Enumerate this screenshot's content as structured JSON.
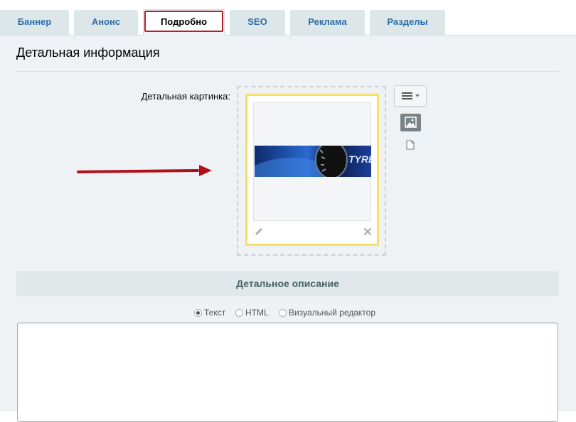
{
  "tabs": [
    {
      "label": "Баннер",
      "active": false
    },
    {
      "label": "Анонс",
      "active": false
    },
    {
      "label": "Подробно",
      "active": true
    },
    {
      "label": "SEO",
      "active": false
    },
    {
      "label": "Реклама",
      "active": false
    },
    {
      "label": "Разделы",
      "active": false
    }
  ],
  "section": {
    "title": "Детальная информация"
  },
  "detail_picture": {
    "label": "Детальная картинка:",
    "edit_icon": "pencil-icon",
    "delete_icon": "close-icon",
    "banner_text": "TYRE"
  },
  "side_controls": {
    "menu_icon": "menu-icon",
    "picture_icon": "image-icon",
    "file_icon": "file-icon"
  },
  "description": {
    "header": "Детальное описание",
    "modes": [
      {
        "label": "Текст",
        "checked": true
      },
      {
        "label": "HTML",
        "checked": false
      },
      {
        "label": "Визуальный редактор",
        "checked": false
      }
    ],
    "value": ""
  },
  "colors": {
    "tab_text": "#2e6fa7",
    "active_tab_border": "#b0222a",
    "image_card_border": "#f5de6a",
    "arrow": "#b0101a",
    "panel_bg": "#eef2f4"
  }
}
